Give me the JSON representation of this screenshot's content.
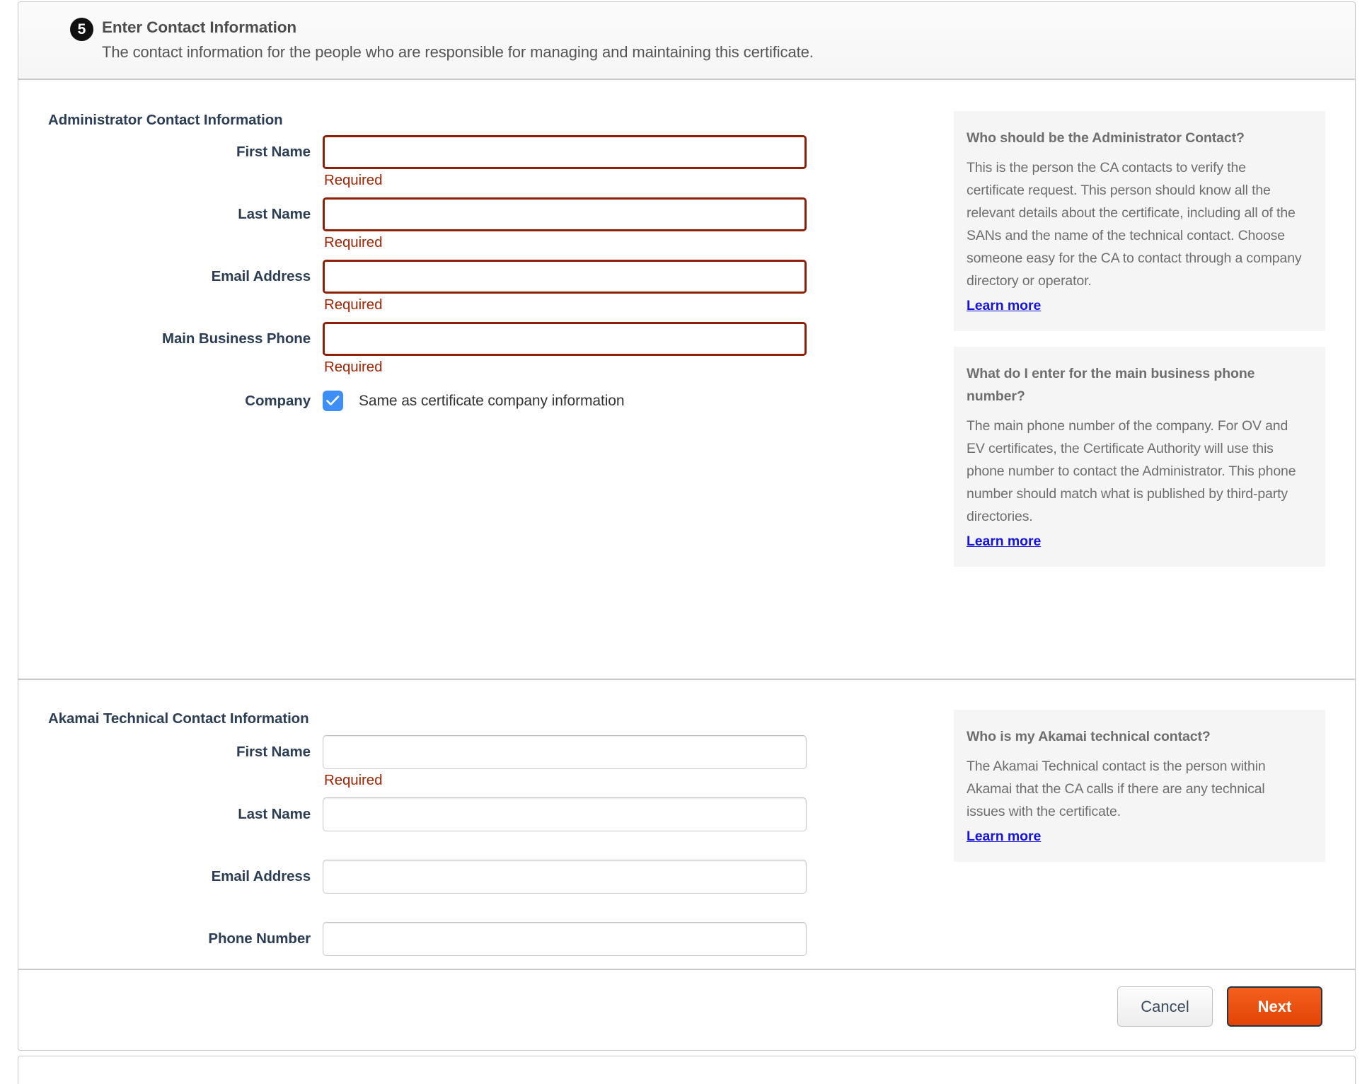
{
  "step": {
    "number": "5",
    "title": "Enter Contact Information",
    "description": "The contact information for the people who are responsible for managing and maintaining this certificate."
  },
  "admin_section": {
    "title": "Administrator Contact Information",
    "fields": [
      {
        "label": "First Name",
        "value": "",
        "error": "Required",
        "state": "error"
      },
      {
        "label": "Last Name",
        "value": "",
        "error": "Required",
        "state": "error"
      },
      {
        "label": "Email Address",
        "value": "",
        "error": "Required",
        "state": "error"
      },
      {
        "label": "Main Business Phone",
        "value": "",
        "error": "Required",
        "state": "error"
      }
    ],
    "company_row": {
      "label": "Company",
      "checkbox_label": "Same as certificate company information",
      "checked": true
    },
    "help": [
      {
        "title": "Who should be the Administrator Contact?",
        "text": "This is the person the CA contacts to verify the certificate request. This person should know all the relevant details about the certificate, including all of the SANs and the name of the technical contact. Choose someone easy for the CA to contact through a company directory or operator.",
        "link": "Learn more"
      },
      {
        "title": "What do I enter for the main business phone number?",
        "text": "The main phone number of the company. For OV and EV certificates, the Certificate Authority will use this phone number to contact the Administrator. This phone number should match what is published by third-party directories.",
        "link": "Learn more"
      }
    ]
  },
  "tech_section": {
    "title": "Akamai Technical Contact Information",
    "fields": [
      {
        "label": "First Name",
        "value": "",
        "error": "Required",
        "state": "normal"
      },
      {
        "label": "Last Name",
        "value": "",
        "error": "",
        "state": "normal"
      },
      {
        "label": "Email Address",
        "value": "",
        "error": "",
        "state": "normal"
      },
      {
        "label": "Phone Number",
        "value": "",
        "error": "",
        "state": "normal"
      }
    ],
    "help": [
      {
        "title": "Who is my Akamai technical contact?",
        "text": "The Akamai Technical contact is the person within Akamai that the CA calls if there are any technical issues with the certificate.",
        "link": "Learn more"
      }
    ]
  },
  "footer": {
    "cancel_label": "Cancel",
    "next_label": "Next"
  },
  "colors": {
    "error_border": "#8d2008",
    "error_text": "#9c2706",
    "label": "#2c3e55",
    "help_text": "#6e6e6e",
    "link": "#1414dd",
    "checkbox": "#3e8ef7",
    "next_button": "#e24405"
  }
}
